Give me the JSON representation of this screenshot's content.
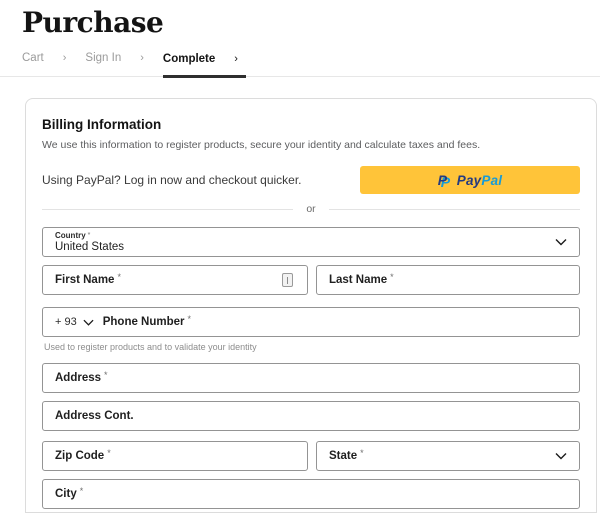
{
  "header": {
    "title": "Purchase"
  },
  "breadcrumb": {
    "separator": "›",
    "cart": "Cart",
    "sign_in": "Sign In",
    "complete": "Complete"
  },
  "billing": {
    "heading": "Billing Information",
    "description": "We use this information to register products, secure your identity and calculate taxes and fees.",
    "paypal_prompt": "Using PayPal? Log in now and checkout quicker.",
    "paypal_button": {
      "brand_first": "Pay",
      "brand_second": "Pal",
      "monogram": "P"
    },
    "divider_label": "or"
  },
  "form": {
    "required_mark": "*",
    "country": {
      "label": "Country",
      "value": "United States"
    },
    "first_name": {
      "label": "First Name"
    },
    "last_name": {
      "label": "Last Name"
    },
    "phone": {
      "dial_code": "+ 93",
      "label": "Phone Number",
      "helper": "Used to register products and to validate your identity"
    },
    "address": {
      "label": "Address"
    },
    "address_cont": {
      "label": "Address Cont."
    },
    "zip": {
      "label": "Zip Code"
    },
    "state": {
      "label": "State"
    },
    "city": {
      "label": "City"
    }
  },
  "colors": {
    "paypal_yellow": "#FFC439",
    "paypal_navy": "#253B80",
    "paypal_blue": "#179BD7",
    "active_tab_underline": "#2F2F2F"
  }
}
